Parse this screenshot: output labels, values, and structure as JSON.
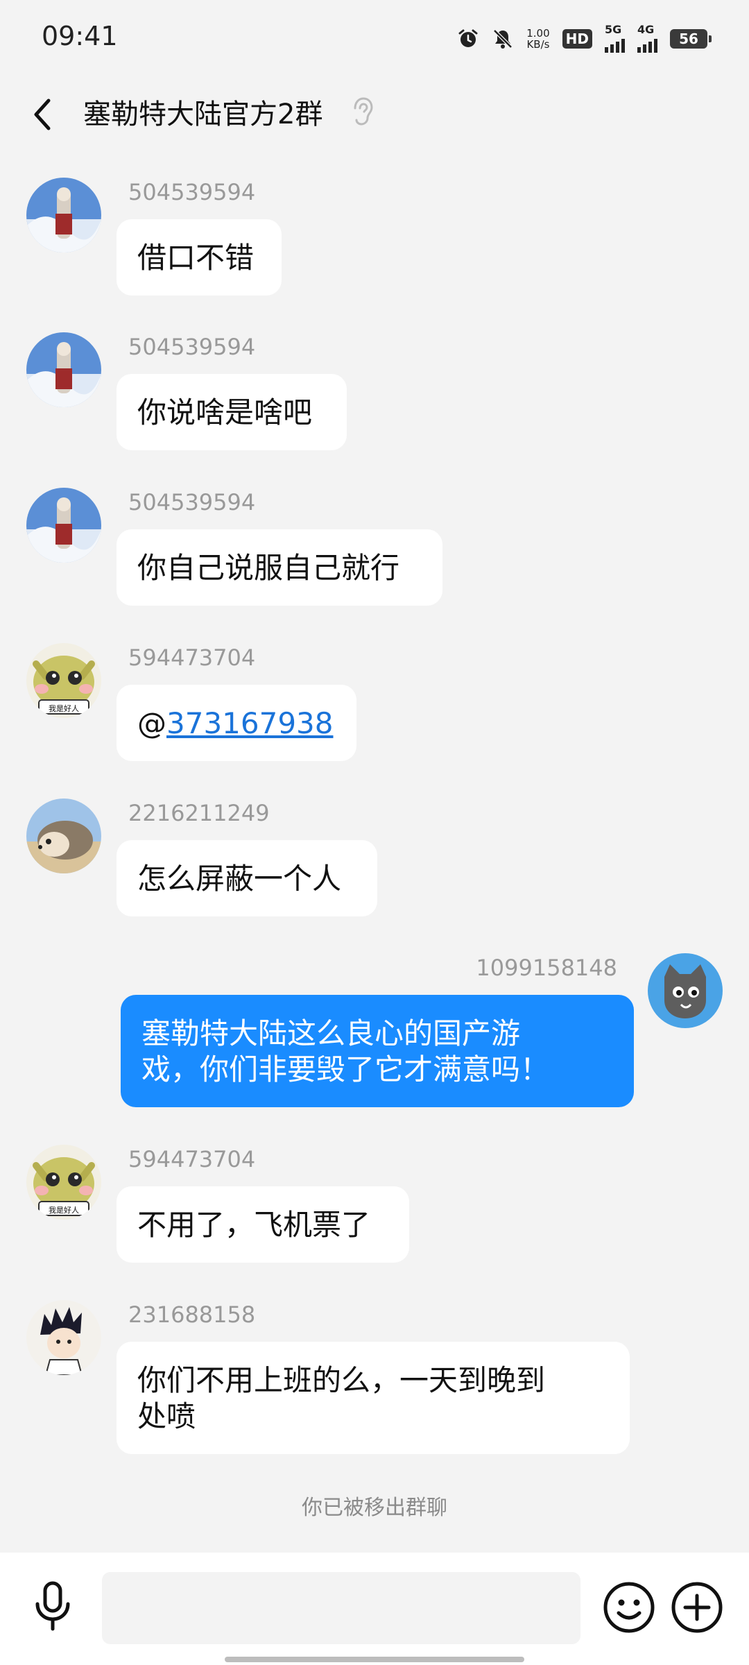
{
  "status_bar": {
    "time": "09:41",
    "net_speed_value": "1.00",
    "net_speed_unit": "KB/s",
    "hd_label": "HD",
    "sim1_label": "5G",
    "sim2_label": "4G",
    "battery": "56",
    "icons": [
      "alarm-icon",
      "mute-icon"
    ]
  },
  "header": {
    "title": "塞勒特大陆官方2群",
    "icons": [
      "back-arrow-icon",
      "ear-icon"
    ]
  },
  "messages": [
    {
      "side": "left",
      "sender": "504539594",
      "text": "借口不错",
      "avatar": "anime-winter-avatar"
    },
    {
      "side": "left",
      "sender": "504539594",
      "text": "你说啥是啥吧",
      "avatar": "anime-winter-avatar"
    },
    {
      "side": "left",
      "sender": "504539594",
      "text": "你自己说服自己就行",
      "avatar": "anime-winter-avatar"
    },
    {
      "side": "left",
      "sender": "594473704",
      "mention_prefix": "@",
      "mention_target": "373167938",
      "avatar": "cat-good-person-avatar",
      "avatar_caption": "我是好人"
    },
    {
      "side": "left",
      "sender": "2216211249",
      "text": "怎么屏蔽一个人",
      "avatar": "hedgehog-avatar"
    },
    {
      "side": "right",
      "sender": "1099158148",
      "text_line1": "塞勒特大陆这么良心的国产游",
      "text_line2": "戏，你们非要毁了它才满意吗！",
      "avatar": "pixel-cat-avatar"
    },
    {
      "side": "left",
      "sender": "594473704",
      "text": "不用了，飞机票了",
      "avatar": "cat-good-person-avatar",
      "avatar_caption": "我是好人"
    },
    {
      "side": "left",
      "sender": "231688158",
      "text_line1": "你们不用上班的么，一天到晚到",
      "text_line2": "处喷",
      "avatar": "anime-boy-avatar"
    }
  ],
  "system_notice": "你已被移出群聊",
  "input_bar": {
    "placeholder": "",
    "icons": [
      "microphone-icon",
      "emoji-icon",
      "plus-icon"
    ]
  },
  "colors": {
    "background": "#f3f3f3",
    "bubble_incoming": "#ffffff",
    "bubble_outgoing": "#1a8cff",
    "link": "#1a73d9",
    "sender_name": "#999999"
  }
}
